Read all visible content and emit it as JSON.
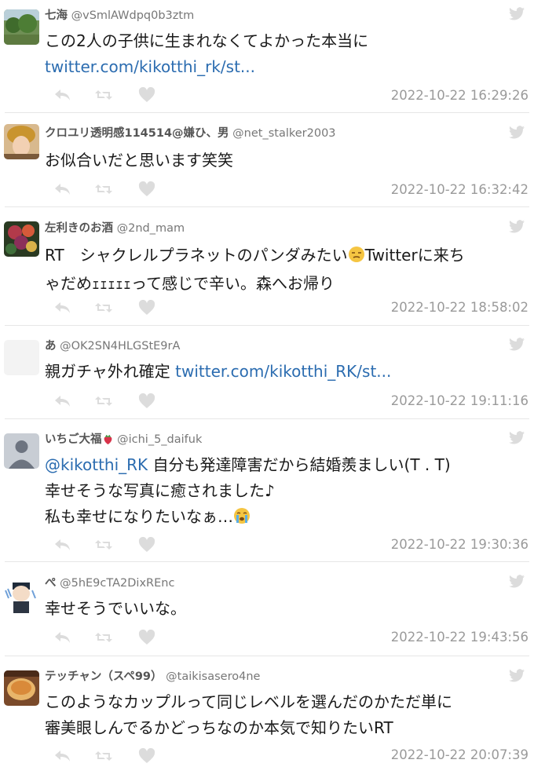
{
  "tweets": [
    {
      "name": "七海",
      "handle": "@vSmlAWdpq0b3ztm",
      "lines": [
        [
          "この2人の子供に生まれなくてよかった本当に",
          ""
        ],
        [
          "",
          "twitter.com/kikotthi_rk/st..."
        ]
      ],
      "time": "2022-10-22 16:29:26"
    },
    {
      "name": "クロユリ透明感114514@嫌ひ、男",
      "handle": "@net_stalker2003",
      "lines": [
        [
          "お似合いだと思います笑笑",
          ""
        ]
      ],
      "time": "2022-10-22 16:32:42"
    },
    {
      "name": "左利きのお酒",
      "handle": "@2nd_mam",
      "lines": [
        [
          "RT　シャクレルプラネットのパンダみたい",
          "Twitterに来ち"
        ],
        [
          "ゃだめｪｪｪｪｪって感じで辛い。森へお帰り",
          ""
        ]
      ],
      "time": "2022-10-22 18:58:02"
    },
    {
      "name": "あ",
      "handle": "@OK2SN4HLGStE9rA",
      "lines": [
        [
          "親ガチャ外れ確定 ",
          "twitter.com/kikotthi_RK/st..."
        ]
      ],
      "time": "2022-10-22 19:11:16"
    },
    {
      "name": "いちご大福",
      "handle": "@ichi_5_daifuk",
      "lines": [
        [
          "@kikotthi_RK",
          " 自分も発達障害だから結婚羨ましい(T . T)"
        ],
        [
          "幸せそうな写真に癒されました♪",
          ""
        ],
        [
          "私も幸せになりたいなぁ…",
          ""
        ]
      ],
      "time": "2022-10-22 19:30:36"
    },
    {
      "name": "ぺ",
      "handle": "@5hE9cTA2DixREnc",
      "lines": [
        [
          "幸せそうでいいな。",
          ""
        ]
      ],
      "time": "2022-10-22 19:43:56"
    },
    {
      "name": "テッチャン（スペ99）",
      "handle": "@taikisasero4ne",
      "lines": [
        [
          "このようなカップルって同じレベルを選んだのかただ単に",
          ""
        ],
        [
          "審美眼しんでるかどっちなのか本気で知りたいRT",
          ""
        ]
      ],
      "time": "2022-10-22 20:07:39"
    }
  ],
  "colors": {
    "link": "#2b6cb0",
    "time": "#9a9a9a",
    "icon": "#dcdcdc"
  }
}
